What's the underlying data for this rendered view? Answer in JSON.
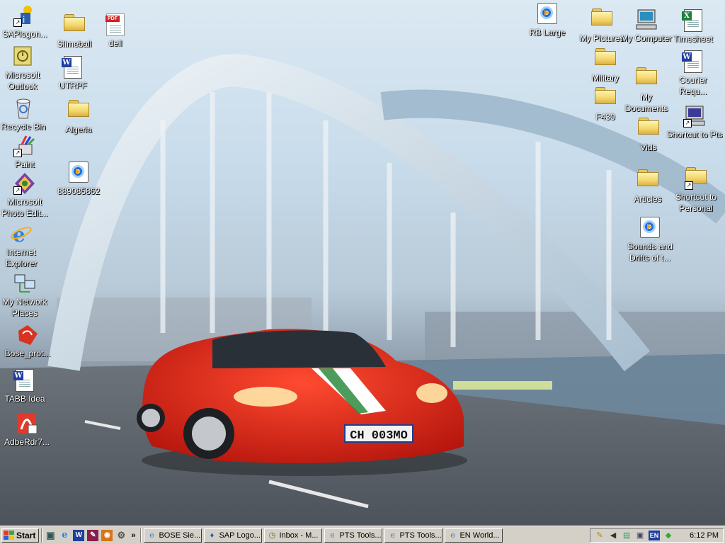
{
  "desktop": {
    "icons_left": [
      {
        "label": "SAPlogon...",
        "icon": "sap-logon-icon"
      },
      {
        "label": "Microsoft Outlook",
        "icon": "outlook-icon"
      },
      {
        "label": "Recycle Bin",
        "icon": "recycle-bin-icon"
      },
      {
        "label": "Paint",
        "icon": "paint-icon"
      },
      {
        "label": "Microsoft Photo Edit...",
        "icon": "photo-editor-icon"
      },
      {
        "label": "Internet Explorer",
        "icon": "internet-explorer-icon"
      },
      {
        "label": "My Network Places",
        "icon": "network-places-icon"
      },
      {
        "label": "Bose_prot...",
        "icon": "bose-icon"
      },
      {
        "label": "TABB Idea",
        "icon": "word-document-icon"
      },
      {
        "label": "AdbeRdr7...",
        "icon": "adobe-reader-installer-icon"
      }
    ],
    "icons_col2": [
      {
        "label": "Slimeball",
        "icon": "folder-icon"
      },
      {
        "label": "dell",
        "icon": "pdf-document-icon"
      },
      {
        "label": "UTRPF",
        "icon": "word-document-icon"
      },
      {
        "label": "Algeria",
        "icon": "folder-icon"
      },
      {
        "label": "889085862",
        "icon": "media-file-icon"
      }
    ],
    "icons_right": [
      {
        "label": "RB Large",
        "icon": "media-file-icon"
      },
      {
        "label": "My Pictures",
        "icon": "pictures-folder-icon"
      },
      {
        "label": "My Computer",
        "icon": "my-computer-icon"
      },
      {
        "label": "Timesheet",
        "icon": "excel-document-icon"
      },
      {
        "label": "Military",
        "icon": "folder-icon"
      },
      {
        "label": "Courier Requ...",
        "icon": "word-document-icon"
      },
      {
        "label": "My Documents",
        "icon": "my-documents-icon"
      },
      {
        "label": "F430",
        "icon": "folder-icon"
      },
      {
        "label": "Shortcut to Pts",
        "icon": "shortcut-icon"
      },
      {
        "label": "Vids",
        "icon": "folder-icon"
      },
      {
        "label": "Articles",
        "icon": "folder-icon"
      },
      {
        "label": "Shortcut to Personal",
        "icon": "folder-shortcut-icon"
      },
      {
        "label": "Sounds and Drifts of t...",
        "icon": "media-file-icon"
      }
    ],
    "wallpaper": {
      "license_plate": "CH 003MO",
      "car_color": "#d8231b",
      "sky_color": "#d6e6f2"
    }
  },
  "taskbar": {
    "start_label": "Start",
    "more_glyph": "»",
    "tasks": [
      {
        "label": "BOSE Sie...",
        "icon": "ie-icon"
      },
      {
        "label": "SAP Logo...",
        "icon": "sap-logon-icon"
      },
      {
        "label": "Inbox - M...",
        "icon": "outlook-icon"
      },
      {
        "label": "PTS Tools...",
        "icon": "ie-icon"
      },
      {
        "label": "PTS Tools...",
        "icon": "ie-icon"
      },
      {
        "label": "EN World...",
        "icon": "ie-icon"
      }
    ],
    "tray": {
      "language": "EN",
      "clock": "6:12 PM"
    }
  }
}
